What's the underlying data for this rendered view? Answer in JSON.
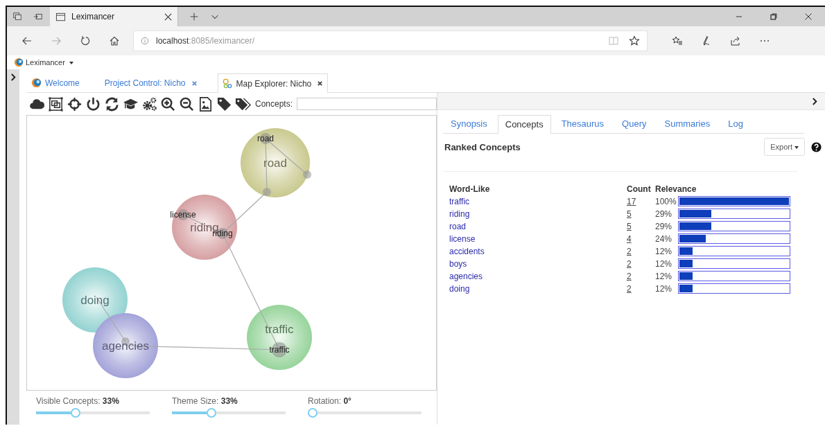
{
  "browser": {
    "tab_title": "Leximancer",
    "url_host": "localhost",
    "url_path": ":8085/leximancer/"
  },
  "app_menu": {
    "label": "Leximancer"
  },
  "app_tabs": [
    {
      "label": "Welcome",
      "kind": "home",
      "selected": false,
      "closable": false
    },
    {
      "label": "Project Control: Nicho",
      "kind": "plain",
      "selected": false,
      "closable": true
    },
    {
      "label": "Map Explorer: Nicho",
      "kind": "map",
      "selected": true,
      "closable": true
    }
  ],
  "toolbar": {
    "concepts_label": "Concepts:"
  },
  "map": {
    "themes": [
      {
        "name": "road",
        "color": "#c9c98f",
        "concepts": [
          {
            "label": "road"
          }
        ]
      },
      {
        "name": "riding",
        "color": "#d6a0a2",
        "concepts": [
          {
            "label": "license"
          },
          {
            "label": "riding"
          }
        ]
      },
      {
        "name": "doing",
        "color": "#93d3d1"
      },
      {
        "name": "agencies",
        "color": "#a3a3d9"
      },
      {
        "name": "traffic",
        "color": "#97d49b",
        "concepts": [
          {
            "label": "traffic"
          }
        ]
      }
    ]
  },
  "sliders": [
    {
      "text": "Visible Concepts: **33%**",
      "level": 0.33
    },
    {
      "text": "Theme Size: **33%**",
      "level": 0.33
    },
    {
      "text": "Rotation: **0°**",
      "level": 0
    }
  ],
  "panel_tabs": [
    {
      "label": "Synopsis",
      "selected": false
    },
    {
      "label": "Concepts",
      "selected": true
    },
    {
      "label": "Thesaurus",
      "selected": false
    },
    {
      "label": "Query",
      "selected": false
    },
    {
      "label": "Summaries",
      "selected": false
    },
    {
      "label": "Log",
      "selected": false
    }
  ],
  "ranked": {
    "title": "Ranked Concepts",
    "export": "Export",
    "columns": [
      "Word-Like",
      "Count",
      "Relevance"
    ],
    "rows": [
      {
        "word": "traffic",
        "count": "17",
        "relevance": "100%",
        "level": 1.0
      },
      {
        "word": "riding",
        "count": "5",
        "relevance": "29%",
        "level": 0.29
      },
      {
        "word": "road",
        "count": "5",
        "relevance": "29%",
        "level": 0.29
      },
      {
        "word": "license",
        "count": "4",
        "relevance": "24%",
        "level": 0.24
      },
      {
        "word": "accidents",
        "count": "2",
        "relevance": "12%",
        "level": 0.12
      },
      {
        "word": "boys",
        "count": "2",
        "relevance": "12%",
        "level": 0.12
      },
      {
        "word": "agencies",
        "count": "2",
        "relevance": "12%",
        "level": 0.12
      },
      {
        "word": "doing",
        "count": "2",
        "relevance": "12%",
        "level": 0.12
      }
    ]
  }
}
